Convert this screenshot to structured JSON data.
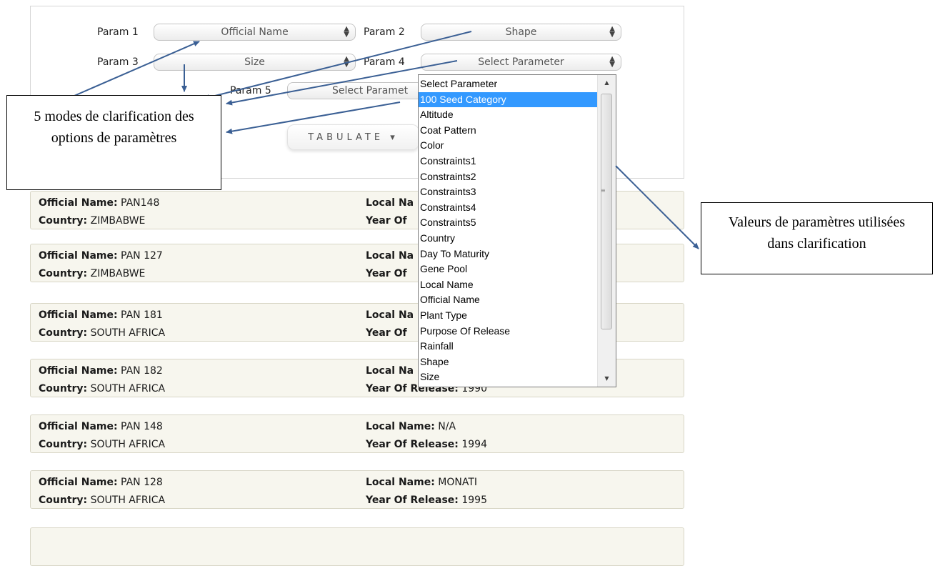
{
  "params": [
    {
      "label": "Param 1",
      "value": "Official Name"
    },
    {
      "label": "Param 2",
      "value": "Shape"
    },
    {
      "label": "Param 3",
      "value": "Size"
    },
    {
      "label": "Param 4",
      "value": "Select Parameter"
    },
    {
      "label": "Param 5",
      "value": "Select Paramet"
    }
  ],
  "tabulate_label": "TABULATE ▾",
  "field_labels": {
    "official": "Official Name:",
    "country": "Country:",
    "local": "Local Name:",
    "year": "Year Of Release:"
  },
  "records": [
    {
      "official": "PAN148",
      "country": "ZIMBABWE",
      "local_partial": "Local Na",
      "year_partial": "Year Of"
    },
    {
      "official": "PAN 127",
      "country": "ZIMBABWE",
      "local_partial": "Local Na",
      "year_partial": "Year Of"
    },
    {
      "official": "PAN 181",
      "country": "SOUTH AFRICA",
      "local_partial": "Local Na",
      "year_partial": "Year Of"
    },
    {
      "official": "PAN 182",
      "country": "SOUTH AFRICA",
      "local_partial": "Local Na",
      "year": "1990"
    },
    {
      "official": "PAN 148",
      "country": "SOUTH AFRICA",
      "local": "N/A",
      "year": "1994"
    },
    {
      "official": "PAN 128",
      "country": "SOUTH AFRICA",
      "local": "MONATI",
      "year": "1995"
    }
  ],
  "dropdown": {
    "options": [
      "Select Parameter",
      "100 Seed Category",
      "Altitude",
      "Coat Pattern",
      "Color",
      "Constraints1",
      "Constraints2",
      "Constraints3",
      "Constraints4",
      "Constraints5",
      "Country",
      "Day To Maturity",
      "Gene Pool",
      "Local Name",
      "Official Name",
      "Plant Type",
      "Purpose Of Release",
      "Rainfall",
      "Shape",
      "Size"
    ],
    "highlighted_index": 1
  },
  "callouts": {
    "left": "5 modes de clarification des options de paramètres",
    "right": "Valeurs de paramètres utilisées dans clarification"
  },
  "colors": {
    "highlight": "#3399ff",
    "row_bg": "#f7f6ee",
    "arrow": "#3a5f94"
  }
}
